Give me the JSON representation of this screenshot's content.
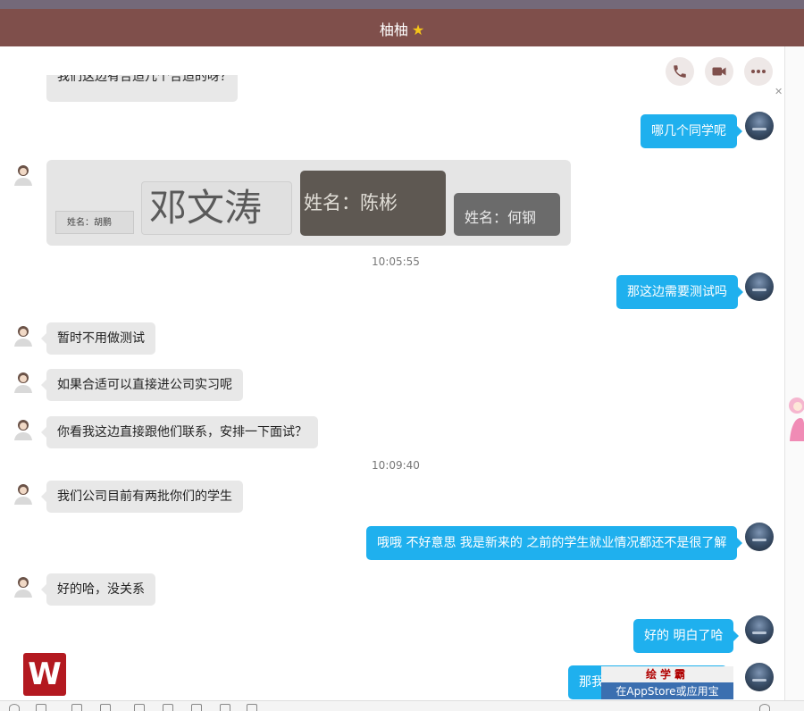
{
  "header": {
    "title": "柚柚"
  },
  "toolbar": {
    "call_icon": "phone-icon",
    "video_icon": "video-camera-icon",
    "more_icon": "more-options-icon"
  },
  "colors": {
    "title_bar": "#7f4f4b",
    "self_bubble": "#1fb0ee",
    "other_bubble": "#e8e8e8"
  },
  "messages": {
    "partial_top": "我们这边有合适几个合适的呀？",
    "m1": "哪几个同学呢",
    "image_names": {
      "a": "姓名：胡鹏",
      "b": "邓文涛",
      "c": "姓名：陈彬",
      "d": "姓名：何钢"
    },
    "time1": "10:05:55",
    "m2": "那这边需要测试吗",
    "m3": "暂时不用做测试",
    "m4": "如果合适可以直接进公司实习呢",
    "m5": "你看我这边直接跟他们联系，安排一下面试？",
    "time2": "10:09:40",
    "m6": "我们公司目前有两批你们的学生",
    "m7": "哦哦  不好意思 我是新来的  之前的学生就业情况都还不是很了解",
    "m8": "好的哈，没关系",
    "m9": "好的  明白了哈",
    "m10": "那我这边把学生联系方式"
  },
  "promo": {
    "title": "绘学霸",
    "subtitle": "在AppStore或应用宝"
  },
  "logo": {
    "letter": "W"
  }
}
